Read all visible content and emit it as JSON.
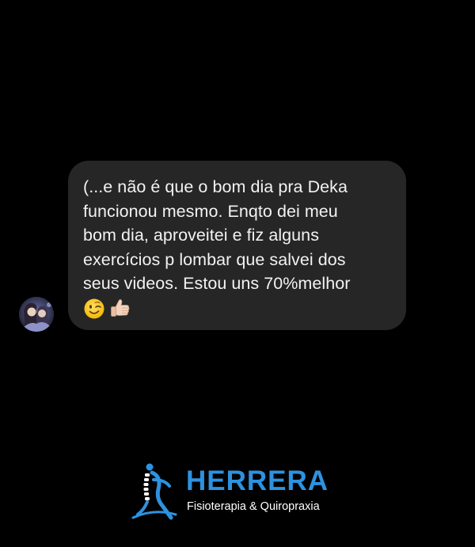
{
  "message": {
    "text": "(...e não é que o bom dia pra Deka\nfuncionou mesmo. Enqto dei meu\nbom dia, aproveitei e fiz alguns\nexercícios p lombar que salvei dos\nseus videos. Estou uns 70%melhor",
    "emojis": [
      "winking-face-emoji",
      "thumbs-up-emoji"
    ]
  },
  "sender": {
    "avatar_icon": "avatar-photo"
  },
  "branding": {
    "name": "HERRERA",
    "tagline": "Fisioterapia & Quiropraxia",
    "brand_color": "#2d92e0",
    "text_color": "#ffffff"
  },
  "colors": {
    "background": "#000000",
    "bubble": "#262626"
  }
}
